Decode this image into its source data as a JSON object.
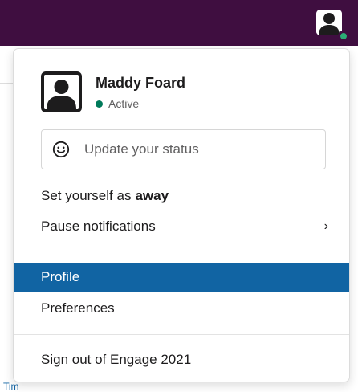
{
  "topbar": {
    "avatar_icon": "user-avatar-icon",
    "presence_color": "#2bac76",
    "background": "#3f0e40"
  },
  "background_text": "Tim",
  "menu": {
    "user": {
      "name": "Maddy Foard",
      "status": "Active",
      "status_color": "#007a5a"
    },
    "status_input": {
      "placeholder": "Update your status",
      "icon": "smile-icon"
    },
    "items": {
      "away_prefix": "Set yourself as",
      "away_bold": "away",
      "pause": "Pause notifications",
      "profile": "Profile",
      "preferences": "Preferences",
      "sign_out": "Sign out of Engage 2021"
    },
    "chevron": "›",
    "active_item": "Profile",
    "accent_color": "#1164a3"
  }
}
